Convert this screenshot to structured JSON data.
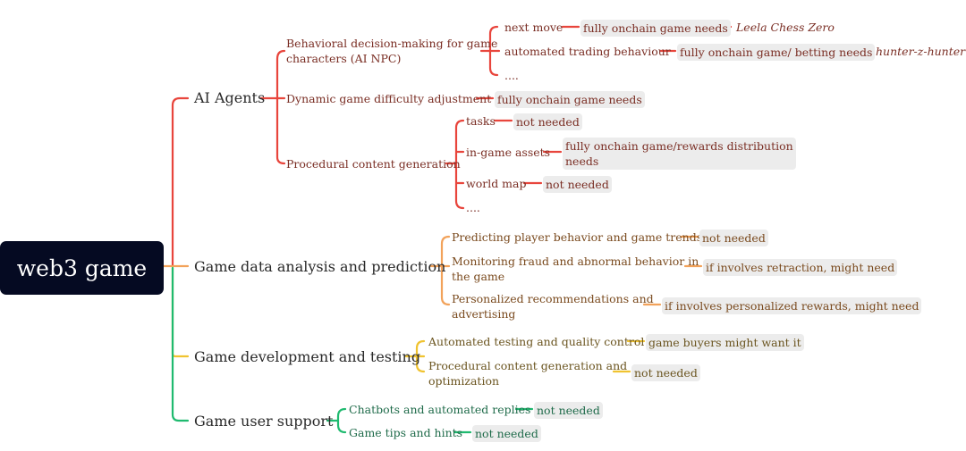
{
  "root": {
    "label": "web3 game"
  },
  "colors": {
    "red": "#e8453c",
    "orange": "#f2a25a",
    "yellow": "#f0c330",
    "green": "#1fba6f",
    "root_bg": "#050a22"
  },
  "branches": [
    {
      "label": "AI Agents",
      "children": [
        {
          "label": "Behavioral decision-making for game characters (AI NPC)",
          "line1": "Behavioral decision-making for game",
          "line2": "characters (AI NPC)",
          "children": [
            {
              "label": "next move",
              "need": "fully onchain game needs",
              "example": "Leela Chess Zero"
            },
            {
              "label": "automated trading behaviour",
              "need": "fully onchain game/ betting needs",
              "example": "hunter-z-hunter"
            },
            {
              "label": "...."
            }
          ]
        },
        {
          "label": "Dynamic game difficulty adjustment",
          "need": "fully onchain game needs"
        },
        {
          "label": "Procedural content generation",
          "children": [
            {
              "label": "tasks",
              "need": "not needed"
            },
            {
              "label": "in-game assets",
              "need_line1": "fully onchain game/rewards distribution",
              "need_line2": "needs"
            },
            {
              "label": "world map",
              "need": "not needed"
            },
            {
              "label": "...."
            }
          ]
        }
      ]
    },
    {
      "label": "Game data analysis and prediction",
      "children": [
        {
          "label": "Predicting player behavior and game trends",
          "need": "not needed"
        },
        {
          "line1": "Monitoring fraud and abnormal behavior in",
          "line2": "the game",
          "need": "if involves retraction, might need"
        },
        {
          "line1": "Personalized recommendations and",
          "line2": "advertising",
          "need": "if involves personalized rewards, might need"
        }
      ]
    },
    {
      "label": "Game development and testing",
      "children": [
        {
          "label": "Automated testing and quality control",
          "need": "game buyers might want it"
        },
        {
          "line1": "Procedural content generation and",
          "line2": "optimization",
          "need": "not needed"
        }
      ]
    },
    {
      "label": "Game user support",
      "children": [
        {
          "label": "Chatbots and automated replies",
          "need": "not needed"
        },
        {
          "label": "Game tips and hints",
          "need": "not needed"
        }
      ]
    }
  ]
}
